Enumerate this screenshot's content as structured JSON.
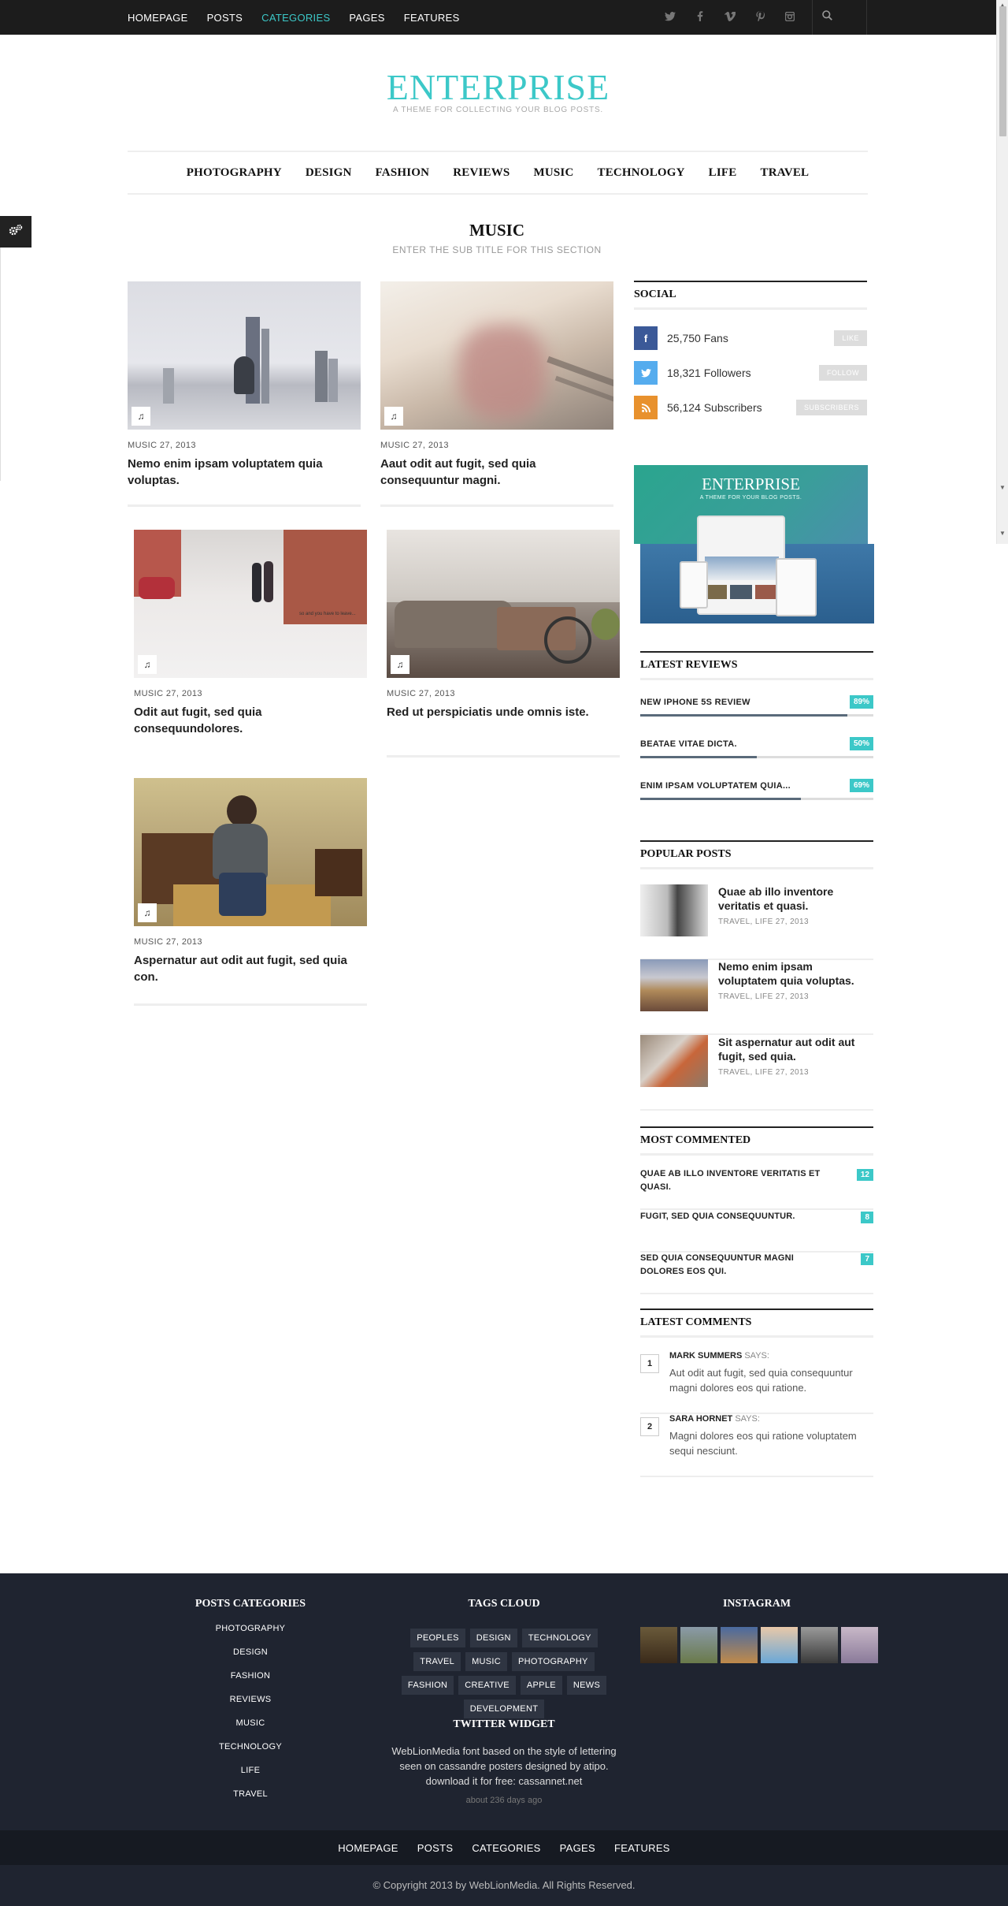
{
  "topnav": {
    "items": [
      "HOMEPAGE",
      "POSTS",
      "CATEGORIES",
      "PAGES",
      "FEATURES"
    ],
    "active": "CATEGORIES"
  },
  "social_icons": [
    "twitter-icon",
    "facebook-icon",
    "vimeo-icon",
    "pinterest-icon",
    "instagram-icon"
  ],
  "search_icon": "search-icon",
  "logo": {
    "title": "ENTERPRISE",
    "tagline": "A THEME FOR COLLECTING YOUR BLOG POSTS."
  },
  "mainnav": [
    "PHOTOGRAPHY",
    "DESIGN",
    "FASHION",
    "REVIEWS",
    "MUSIC",
    "TECHNOLOGY",
    "LIFE",
    "TRAVEL"
  ],
  "section": {
    "title": "MUSIC",
    "subtitle": "ENTER THE SUB TITLE FOR THIS SECTION"
  },
  "posts": [
    {
      "date": "MUSIC 27, 2013",
      "title": "Nemo enim ipsam voluptatem quia voluptas.",
      "icon": "music-note-icon"
    },
    {
      "date": "MUSIC 27, 2013",
      "title": "Aaut odit aut fugit, sed quia consequuntur magni.",
      "icon": "music-note-icon"
    },
    {
      "date": "MUSIC 27, 2013",
      "title": "Odit aut fugit, sed quia consequundolores.",
      "icon": "music-note-icon"
    },
    {
      "date": "MUSIC 27, 2013",
      "title": "Red ut perspiciatis unde omnis iste.",
      "icon": "music-note-icon"
    },
    {
      "date": "MUSIC 27, 2013",
      "title": "Aspernatur aut odit aut fugit, sed quia con.",
      "icon": "music-note-icon"
    }
  ],
  "sidebar": {
    "social": {
      "heading": "SOCIAL",
      "rows": [
        {
          "icon": "facebook-icon",
          "text": "25,750 Fans",
          "button": "LIKE",
          "color": "#3b5998"
        },
        {
          "icon": "twitter-icon",
          "text": "18,321 Followers",
          "button": "FOLLOW",
          "color": "#55acee"
        },
        {
          "icon": "rss-icon",
          "text": "56,124 Subscribers",
          "button": "SUBSCRIBERS",
          "color": "#e8912d"
        }
      ]
    },
    "ad": {
      "title": "ENTERPRISE",
      "tagline": "A THEME FOR YOUR BLOG POSTS."
    },
    "reviews": {
      "heading": "LATEST REVIEWS",
      "items": [
        {
          "name": "NEW IPHONE 5S REVIEW",
          "percent": "89%",
          "value": 0.89
        },
        {
          "name": "BEATAE VITAE DICTA.",
          "percent": "50%",
          "value": 0.5
        },
        {
          "name": "ENIM IPSAM VOLUPTATEM QUIA...",
          "percent": "69%",
          "value": 0.69
        }
      ]
    },
    "popular": {
      "heading": "POPULAR POSTS",
      "items": [
        {
          "title": "Quae ab illo inventore veritatis et quasi.",
          "meta": "TRAVEL, LIFE 27, 2013"
        },
        {
          "title": "Nemo enim ipsam voluptatem quia voluptas.",
          "meta": "TRAVEL, LIFE 27, 2013"
        },
        {
          "title": "Sit aspernatur aut odit aut fugit, sed quia.",
          "meta": "TRAVEL, LIFE 27, 2013"
        }
      ]
    },
    "commented": {
      "heading": "MOST COMMENTED",
      "items": [
        {
          "title": "QUAE AB ILLO INVENTORE VERITATIS ET QUASI.",
          "count": "12"
        },
        {
          "title": "FUGIT, SED QUIA CONSEQUUNTUR.",
          "count": "8"
        },
        {
          "title": "SED QUIA CONSEQUUNTUR MAGNI DOLORES EOS QUI.",
          "count": "7"
        }
      ]
    },
    "comments": {
      "heading": "LATEST COMMENTS",
      "says": "SAYS:",
      "items": [
        {
          "num": "1",
          "author": "MARK SUMMERS",
          "text": "Aut odit aut fugit, sed quia consequuntur magni dolores eos qui ratione."
        },
        {
          "num": "2",
          "author": "SARA HORNET",
          "text": "Magni dolores eos qui ratione voluptatem sequi nesciunt."
        }
      ]
    }
  },
  "footer": {
    "categories": {
      "heading": "POSTS CATEGORIES",
      "items": [
        "PHOTOGRAPHY",
        "DESIGN",
        "FASHION",
        "REVIEWS",
        "MUSIC",
        "TECHNOLOGY",
        "LIFE",
        "TRAVEL"
      ]
    },
    "tags": {
      "heading": "TAGS CLOUD",
      "items": [
        "PEOPLES",
        "DESIGN",
        "TECHNOLOGY",
        "TRAVEL",
        "MUSIC",
        "PHOTOGRAPHY",
        "FASHION",
        "CREATIVE",
        "APPLE",
        "NEWS",
        "DEVELOPMENT"
      ]
    },
    "instagram": {
      "heading": "INSTAGRAM"
    },
    "twitter": {
      "heading": "TWITTER WIDGET",
      "text": "WebLionMedia font based on the style of lettering seen on cassandre posters designed by atipo. download it for free: cassannet.net",
      "time": "about 236 days ago"
    },
    "nav": [
      "HOMEPAGE",
      "POSTS",
      "CATEGORIES",
      "PAGES",
      "FEATURES"
    ],
    "copyright": "© Copyright 2013 by WebLionMedia. All Rights Reserved."
  }
}
